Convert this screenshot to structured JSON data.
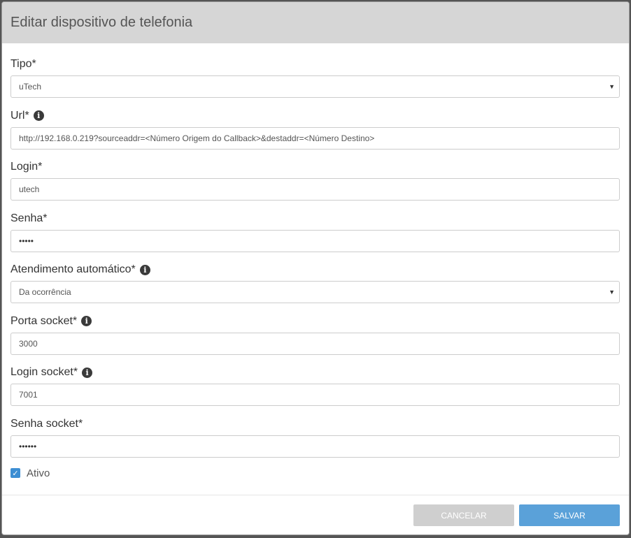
{
  "dialog": {
    "title": "Editar dispositivo de telefonia"
  },
  "fields": {
    "tipo": {
      "label": "Tipo*",
      "value": "uTech",
      "caret": "▼"
    },
    "url": {
      "label": "Url*",
      "value": "http://192.168.0.219?sourceaddr=<Número Origem do Callback>&destaddr=<Número Destino>"
    },
    "login": {
      "label": "Login*",
      "value": "utech"
    },
    "senha": {
      "label": "Senha*",
      "value": "•••••"
    },
    "atendimento": {
      "label": "Atendimento automático*",
      "value": "Da ocorrência",
      "caret": "▼"
    },
    "porta_socket": {
      "label": "Porta socket*",
      "value": "3000"
    },
    "login_socket": {
      "label": "Login socket*",
      "value": "7001"
    },
    "senha_socket": {
      "label": "Senha socket*",
      "value": "••••••"
    }
  },
  "info_icon_glyph": "i",
  "ativo": {
    "label": "Ativo",
    "checked": true,
    "check_glyph": "✓"
  },
  "buttons": {
    "cancel": "CANCELAR",
    "save": "SALVAR"
  },
  "colors": {
    "header_bg": "#d6d6d6",
    "checkbox": "#3d8ed3",
    "save_button": "#5aa1d9",
    "cancel_button": "#cfcfcf"
  },
  "icons": [
    "info-icon",
    "chevron-down-icon",
    "check-icon"
  ]
}
